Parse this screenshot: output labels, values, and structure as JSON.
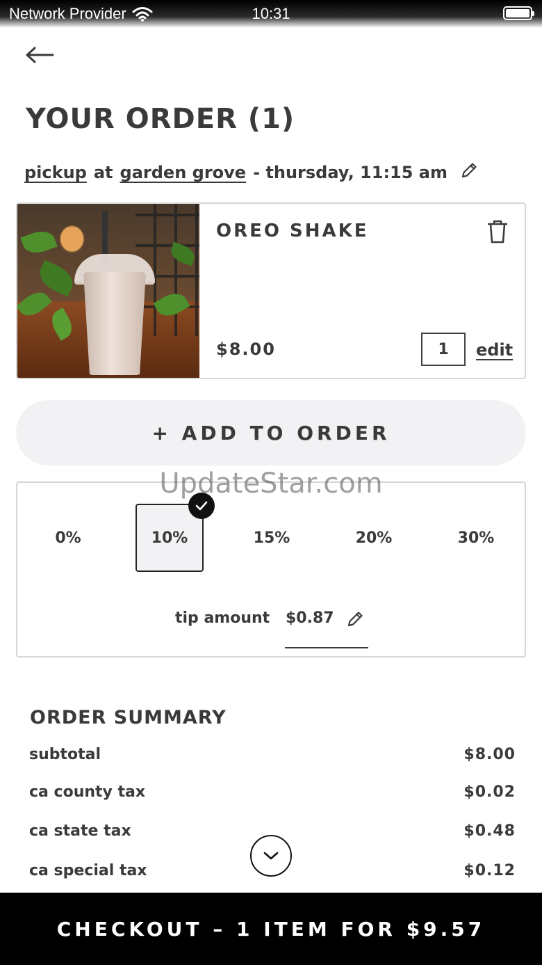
{
  "status_bar": {
    "carrier": "Network Provider",
    "time": "10:31"
  },
  "header": {
    "title": "YOUR ORDER (1)"
  },
  "pickup": {
    "mode": "pickup",
    "at": "at",
    "location": "garden grove",
    "when": "- thursday, 11:15 am"
  },
  "item": {
    "name": "OREO SHAKE",
    "price": "$8.00",
    "quantity": "1",
    "edit_label": "edit"
  },
  "add_to_order": {
    "label": "+ ADD TO ORDER"
  },
  "watermark": "UpdateStar.com",
  "tip": {
    "options": [
      "0%",
      "10%",
      "15%",
      "20%",
      "30%"
    ],
    "selected": "10%",
    "amount_label": "tip amount",
    "amount": "$0.87"
  },
  "summary": {
    "title": "ORDER SUMMARY",
    "rows": [
      {
        "label": "subtotal",
        "amount": "$8.00"
      },
      {
        "label": "ca county tax",
        "amount": "$0.02"
      },
      {
        "label": "ca state tax",
        "amount": "$0.48"
      },
      {
        "label": "ca special tax",
        "amount": "$0.12"
      }
    ]
  },
  "checkout": {
    "label": "CHECKOUT – 1 ITEM FOR $9.57"
  },
  "icons": [
    "wifi-icon",
    "battery-icon",
    "back-arrow-icon",
    "pencil-icon",
    "trash-icon",
    "check-icon",
    "chevron-down-icon"
  ]
}
